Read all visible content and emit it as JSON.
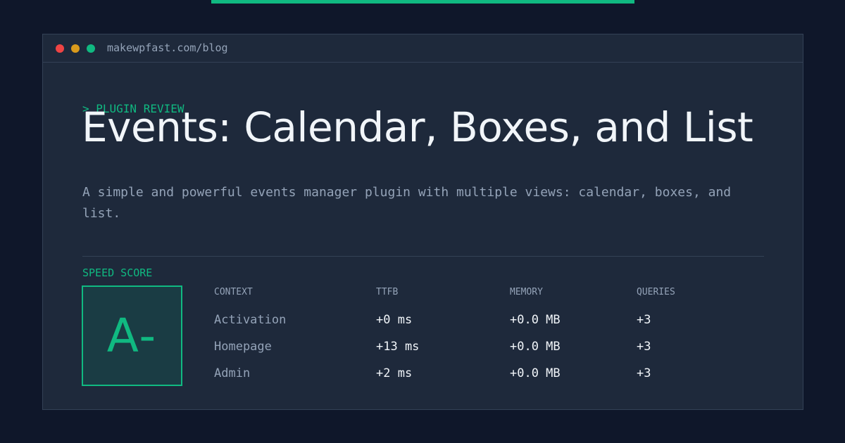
{
  "window": {
    "url": "makewpfast.com/blog"
  },
  "header": {
    "eyebrow": "> PLUGIN REVIEW",
    "title": "Events: Calendar, Boxes, and List",
    "description": "A simple and powerful events manager plugin with multiple views: calendar, boxes, and list."
  },
  "speed": {
    "label": "SPEED SCORE",
    "grade": "A-"
  },
  "table": {
    "headers": [
      "CONTEXT",
      "TTFB",
      "MEMORY",
      "QUERIES"
    ],
    "rows": [
      [
        "Activation",
        "+0 ms",
        "+0.0 MB",
        "+3"
      ],
      [
        "Homepage",
        "+13 ms",
        "+0.0 MB",
        "+3"
      ],
      [
        "Admin",
        "+2 ms",
        "+0.0 MB",
        "+3"
      ]
    ]
  },
  "colors": {
    "accent": "#10b981",
    "background": "#0f172a",
    "panel": "#1e293b",
    "muted_text": "#94a3b8",
    "bright_text": "#f1f5f9"
  }
}
